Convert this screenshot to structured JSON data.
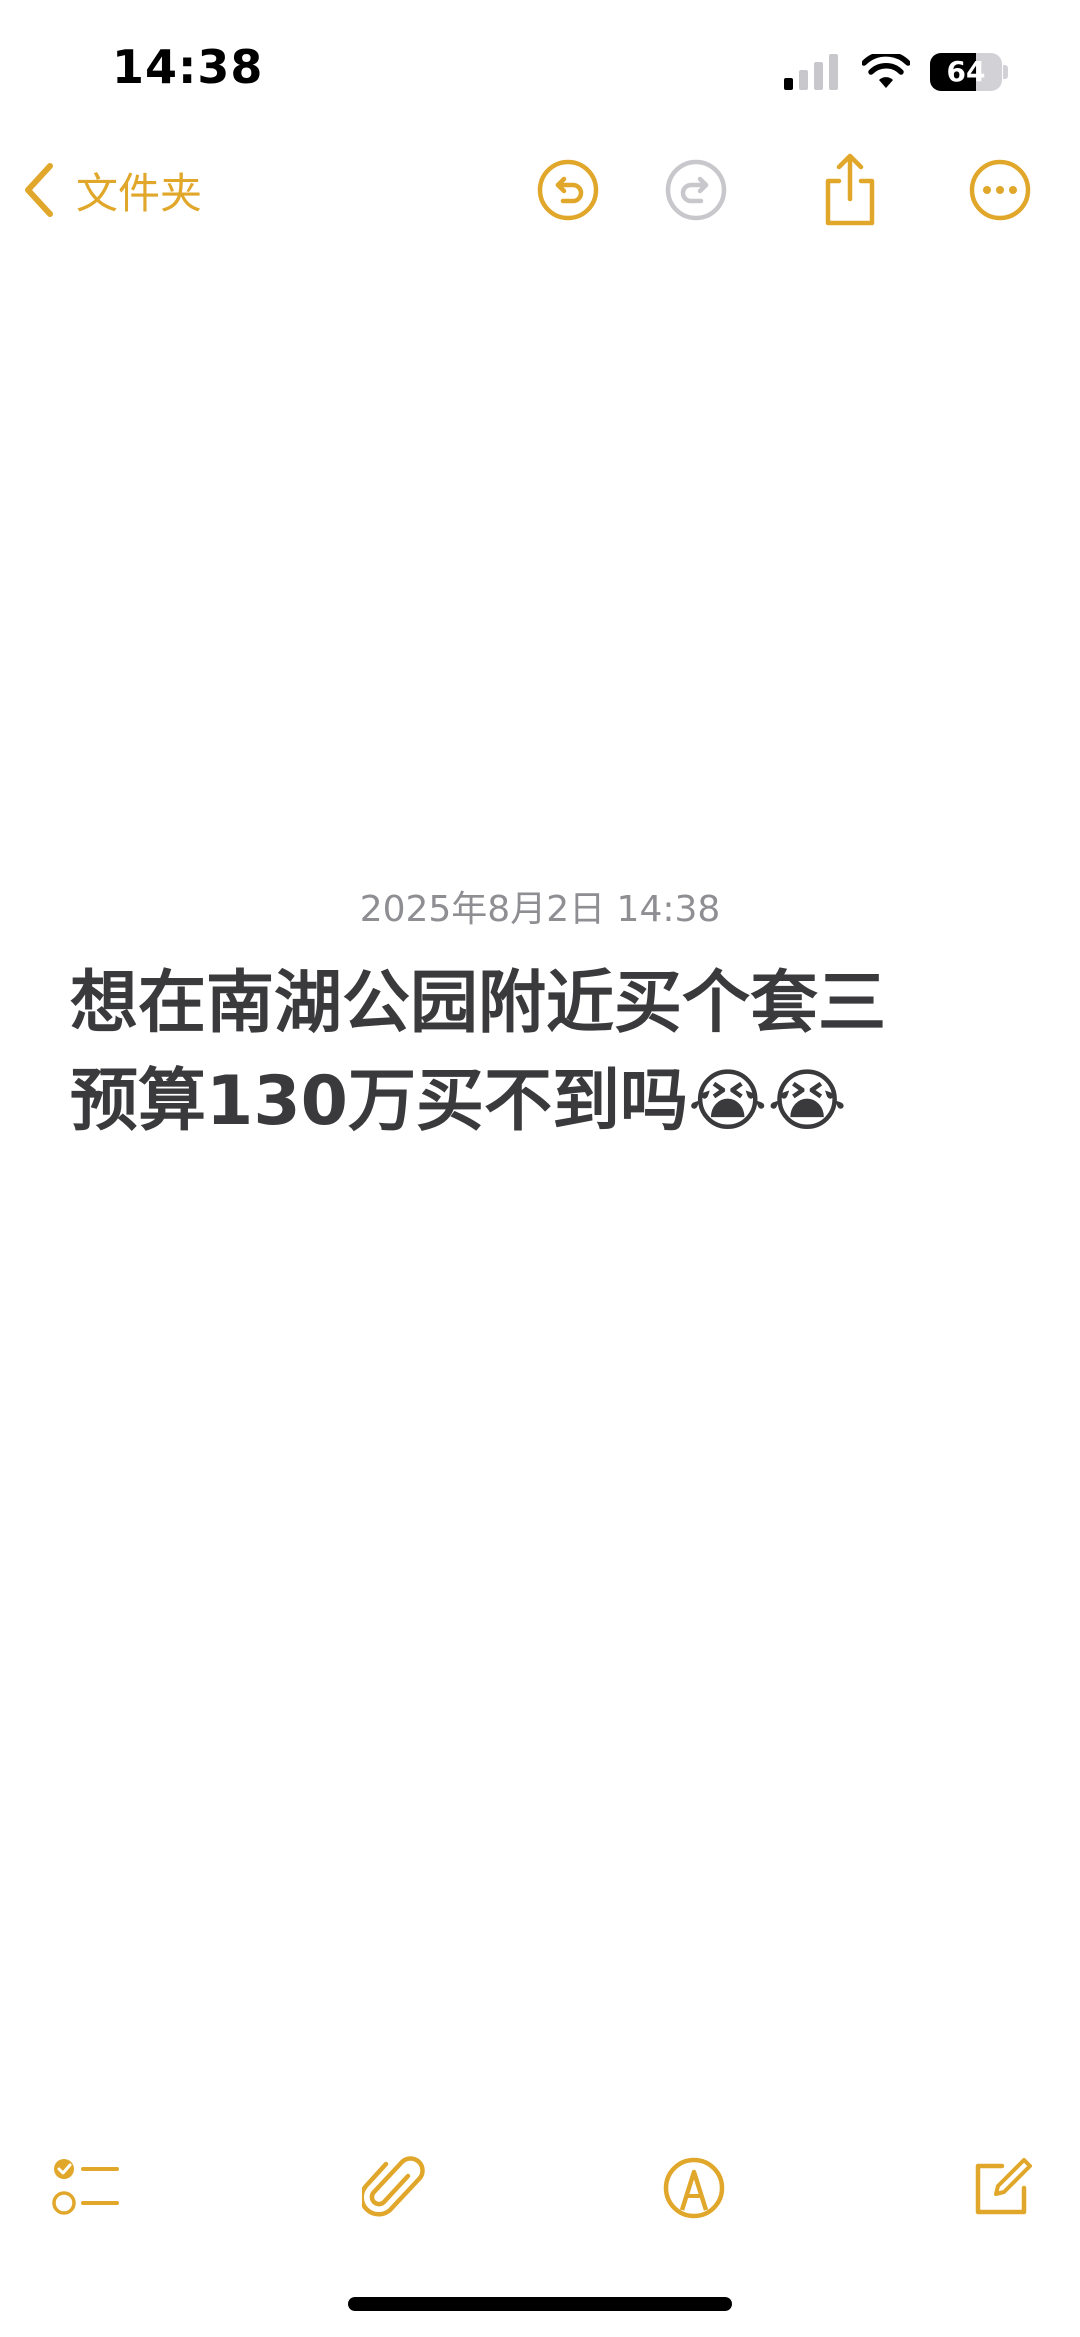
{
  "status_bar": {
    "time": "14:38",
    "battery_percent": "64",
    "battery_level": 0.64
  },
  "nav": {
    "back_label": "文件夹"
  },
  "note": {
    "date": "2025年8月2日 14:38",
    "lines": [
      "想在南湖公园附近买个套三",
      "预算130万买不到吗😭😭"
    ]
  },
  "icons": {
    "back": "chevron-left-icon",
    "undo": "undo-icon",
    "redo": "redo-icon",
    "share": "share-icon",
    "more": "ellipsis-circle-icon",
    "checklist": "checklist-icon",
    "attachment": "paperclip-icon",
    "markup": "pen-tip-icon",
    "compose": "compose-icon"
  },
  "colors": {
    "accent": "#e0a72b",
    "disabled": "#c7c7cc",
    "title_text": "#3a3a3c",
    "date_text": "#8e8e93"
  }
}
